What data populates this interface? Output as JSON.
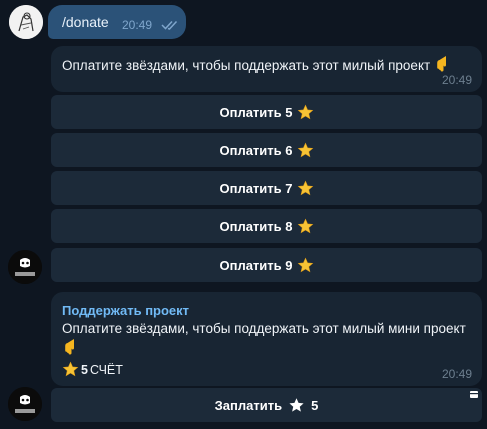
{
  "outgoing": {
    "text": "/donate",
    "time": "20:49",
    "status_icon": "double-check-icon"
  },
  "message1": {
    "text": "Оплатите звёздами, чтобы поддержать этот милый проект",
    "emoji": "pointing-down-hand",
    "time": "20:49"
  },
  "buttons": [
    {
      "label": "Оплатить 5",
      "icon": "gold-star"
    },
    {
      "label": "Оплатить 6",
      "icon": "gold-star"
    },
    {
      "label": "Оплатить 7",
      "icon": "gold-star"
    },
    {
      "label": "Оплатить 8",
      "icon": "gold-star"
    },
    {
      "label": "Оплатить 9",
      "icon": "gold-star"
    }
  ],
  "invoice": {
    "title": "Поддержать проект",
    "description": "Оплатите звёздами, чтобы поддержать этот милый мини проект",
    "emoji": "pointing-down-hand",
    "price_amount": "5",
    "price_label": "СЧЁТ",
    "time": "20:49",
    "pay_button": {
      "label": "Заплатить",
      "amount": "5",
      "icon": "white-star"
    }
  },
  "colors": {
    "background": "#0e1621",
    "incoming_bubble": "#182533",
    "outgoing_bubble": "#2b5278",
    "button": "#1c2a39",
    "link_title": "#71baf5",
    "star_gold": "#f7c335"
  }
}
